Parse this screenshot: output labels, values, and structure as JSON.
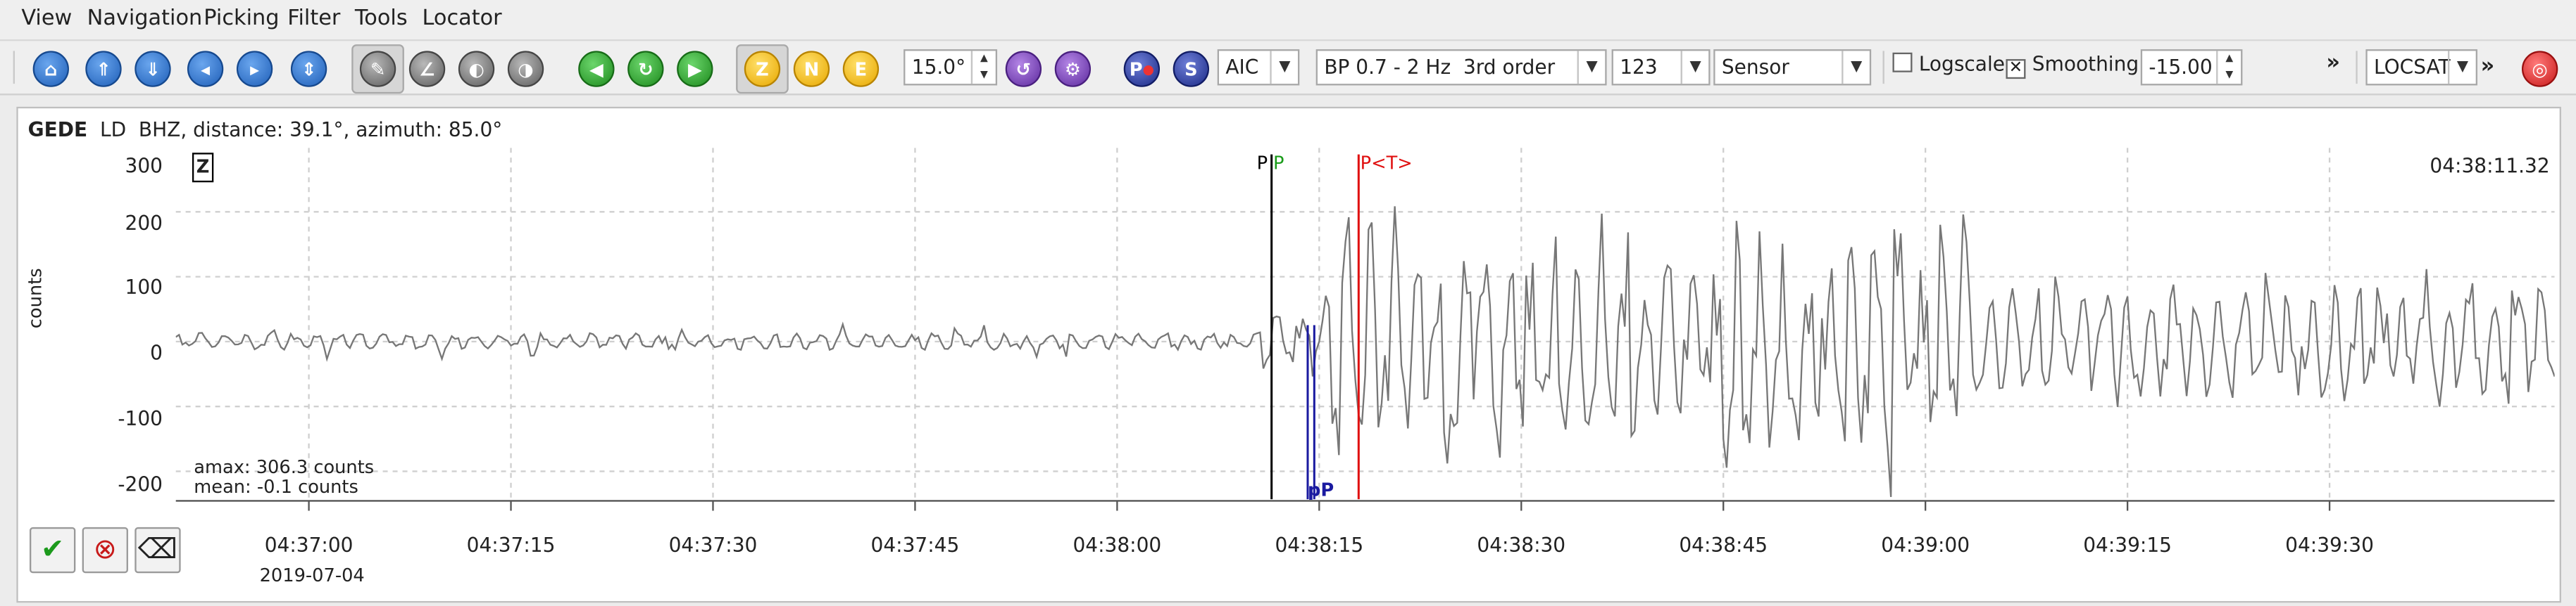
{
  "menu": {
    "items": [
      "View",
      "Navigation",
      "Picking",
      "Filter",
      "Tools",
      "Locator"
    ]
  },
  "toolbar": {
    "icons": [
      "home-icon",
      "scroll-up-icon",
      "scroll-down-icon",
      "step-left-icon",
      "step-right-icon",
      "expand-icon",
      "hand-icon",
      "angle-icon",
      "measure-icon",
      "trace-icon",
      "previous-pick-icon",
      "refresh-icon",
      "next-pick-icon"
    ],
    "component_buttons": [
      "Z",
      "N",
      "E"
    ],
    "rotation_value": "15.0°",
    "phase_buttons": [
      "P",
      "S"
    ],
    "picker_select": "AIC",
    "filter_select": "BP 0.7 - 2 Hz  3rd order",
    "channel_select": "123",
    "unit_select": "Sensor",
    "logscale_label": "Logscale",
    "logscale_checked": false,
    "smoothing_label": "Smoothing",
    "smoothing_checked": true,
    "smoothing_value": "-15.00",
    "overflow_label": "»",
    "locator_select": "LOCSAT",
    "overflow2_label": "»"
  },
  "trace": {
    "station": "GEDE",
    "network_channel": "LD  BHZ, distance: 39.1°, azimuth: 85.0°",
    "component": "Z",
    "y_axis_label": "counts",
    "y_ticks": [
      "300",
      "200",
      "100",
      "0",
      "-100",
      "-200"
    ],
    "x_ticks": [
      "04:37:00",
      "04:37:15",
      "04:37:30",
      "04:37:45",
      "04:38:00",
      "04:38:15",
      "04:38:30",
      "04:38:45",
      "04:39:00",
      "04:39:15",
      "04:39:30"
    ],
    "date": "2019-07-04",
    "corner_time": "04:38:11.32",
    "amax": "amax: 306.3 counts",
    "mean": "mean: -0.1 counts",
    "picks": [
      {
        "label": "P",
        "color": "#000000"
      },
      {
        "label": "P",
        "color": "#1a9c1a"
      },
      {
        "label": "P<T>",
        "color": "#e01010"
      },
      {
        "label": "pP",
        "color": "#1a1aa0"
      }
    ]
  },
  "bottom_buttons": [
    "accept-icon",
    "reject-icon",
    "delete-icon"
  ],
  "colors": {
    "trace": "#777777",
    "grid": "#cfcfcf",
    "pick_black": "#000000",
    "pick_green": "#1a9c1a",
    "pick_red": "#e01010",
    "pick_blue": "#1a1aa0"
  }
}
